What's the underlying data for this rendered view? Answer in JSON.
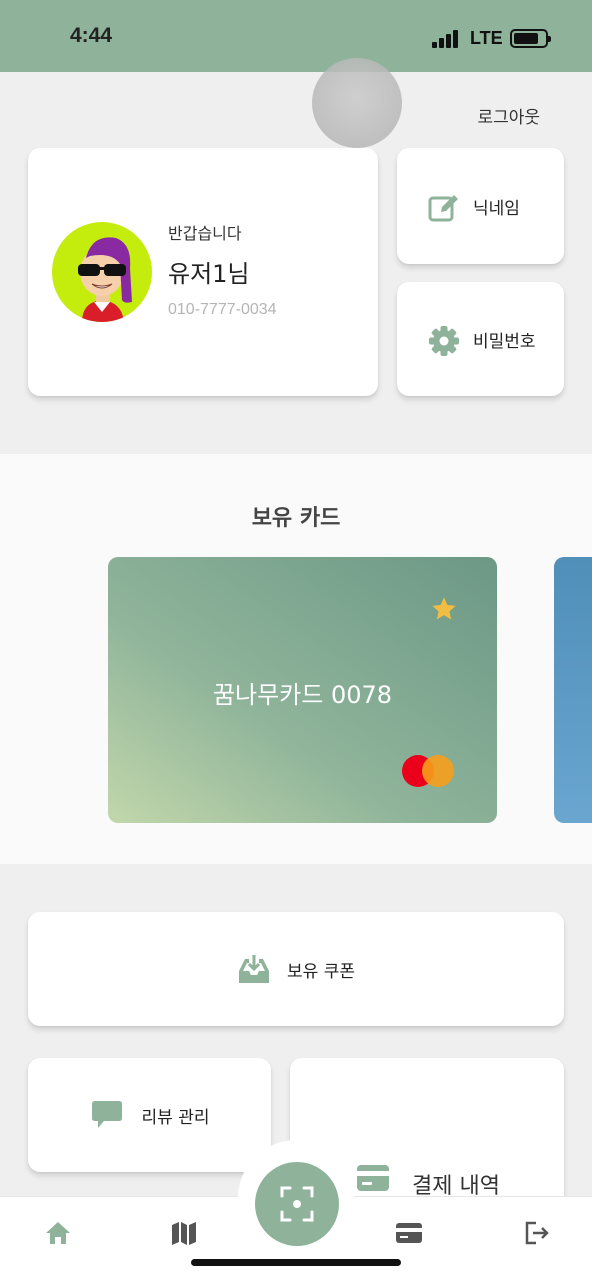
{
  "status_bar": {
    "time": "4:44",
    "network": "LTE"
  },
  "header": {
    "logout_label": "로그아웃"
  },
  "profile": {
    "greeting": "반갑습니다",
    "name": "유저1님",
    "phone": "010-7777-0034"
  },
  "actions": {
    "nickname_label": "닉네임",
    "password_label": "비밀번호"
  },
  "cards": {
    "section_title": "보유 카드",
    "items": [
      {
        "name": "꿈나무카드 0078",
        "favorite": true,
        "brand": "mastercard"
      }
    ]
  },
  "menu": {
    "coupon_label": "보유 쿠폰",
    "review_label": "리뷰 관리",
    "payment_history_label": "결제 내역"
  },
  "nav": {
    "items": [
      "home-icon",
      "map-icon",
      "scan-icon",
      "card-icon",
      "logout-icon"
    ]
  },
  "colors": {
    "accent": "#8fb39a",
    "star": "#f2bd42",
    "mc_red": "#eb001b",
    "mc_orange": "#f79e1b"
  }
}
